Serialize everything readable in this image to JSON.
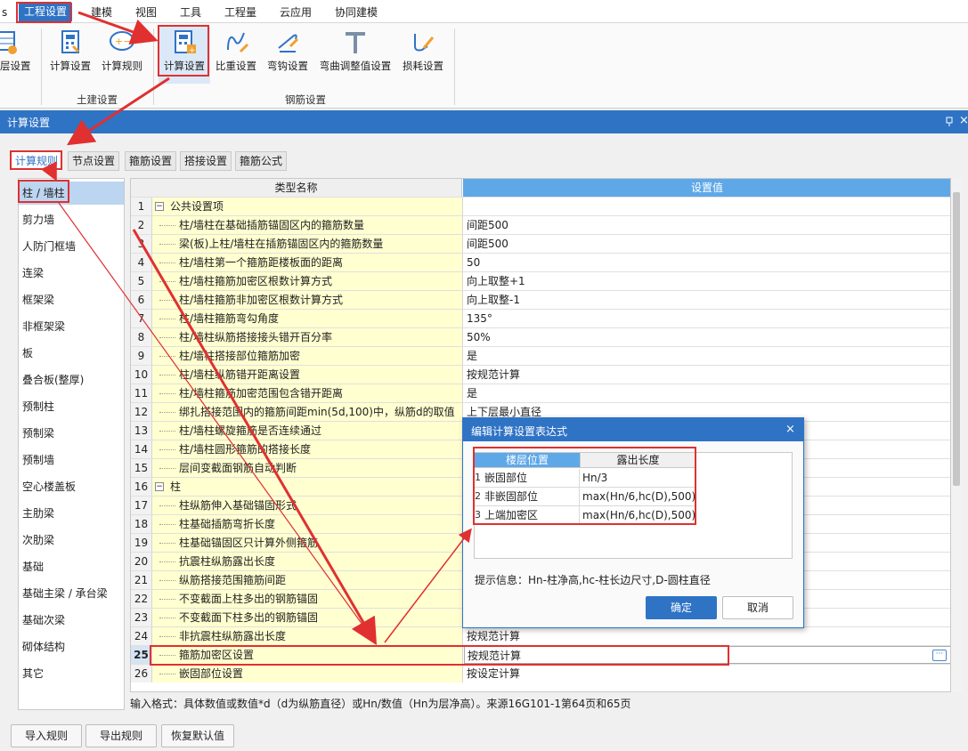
{
  "menu": {
    "items": [
      "工程设置",
      "建模",
      "视图",
      "工具",
      "工程量",
      "云应用",
      "协同建模"
    ]
  },
  "ribbon": {
    "buttons": [
      {
        "label": "层设置"
      },
      {
        "label": "计算设置"
      },
      {
        "label": "计算规则"
      },
      {
        "label": "计算设置"
      },
      {
        "label": "比重设置"
      },
      {
        "label": "弯钩设置"
      },
      {
        "label": "弯曲调整值设置"
      },
      {
        "label": "损耗设置"
      }
    ],
    "groups": [
      "土建设置",
      "钢筋设置"
    ]
  },
  "dialog": {
    "title": "计算设置",
    "close": "×",
    "tabs": [
      "计算规则",
      "节点设置",
      "箍筋设置",
      "搭接设置",
      "箍筋公式"
    ],
    "nav": [
      "柱 / 墙柱",
      "剪力墙",
      "人防门框墙",
      "连梁",
      "框架梁",
      "非框架梁",
      "板",
      "叠合板(整厚)",
      "预制柱",
      "预制梁",
      "预制墙",
      "空心楼盖板",
      "主肋梁",
      "次肋梁",
      "基础",
      "基础主梁 / 承台梁",
      "基础次梁",
      "砌体结构",
      "其它"
    ],
    "grid": {
      "headers": [
        "类型名称",
        "设置值"
      ],
      "rows": [
        {
          "n": "1",
          "name": "公共设置项",
          "value": "",
          "group": true,
          "toggle": "−"
        },
        {
          "n": "2",
          "name": "柱/墙柱在基础插筋锚固区内的箍筋数量",
          "value": "间距500"
        },
        {
          "n": "3",
          "name": "梁(板)上柱/墙柱在插筋锚固区内的箍筋数量",
          "value": "间距500"
        },
        {
          "n": "4",
          "name": "柱/墙柱第一个箍筋距楼板面的距离",
          "value": "50"
        },
        {
          "n": "5",
          "name": "柱/墙柱箍筋加密区根数计算方式",
          "value": "向上取整+1"
        },
        {
          "n": "6",
          "name": "柱/墙柱箍筋非加密区根数计算方式",
          "value": "向上取整-1"
        },
        {
          "n": "7",
          "name": "柱/墙柱箍筋弯勾角度",
          "value": "135°"
        },
        {
          "n": "8",
          "name": "柱/墙柱纵筋搭接接头错开百分率",
          "value": "50%"
        },
        {
          "n": "9",
          "name": "柱/墙柱搭接部位箍筋加密",
          "value": "是"
        },
        {
          "n": "10",
          "name": "柱/墙柱纵筋错开距离设置",
          "value": "按规范计算"
        },
        {
          "n": "11",
          "name": "柱/墙柱箍筋加密范围包含错开距离",
          "value": "是"
        },
        {
          "n": "12",
          "name": "绑扎搭接范围内的箍筋间距min(5d,100)中，纵筋d的取值",
          "value": "上下层最小直径"
        },
        {
          "n": "13",
          "name": "柱/墙柱螺旋箍筋是否连续通过",
          "value": ""
        },
        {
          "n": "14",
          "name": "柱/墙柱圆形箍筋的搭接长度",
          "value": ""
        },
        {
          "n": "15",
          "name": "层间变截面钢筋自动判断",
          "value": ""
        },
        {
          "n": "16",
          "name": "柱",
          "value": "",
          "group": true,
          "toggle": "−"
        },
        {
          "n": "17",
          "name": "柱纵筋伸入基础锚固形式",
          "value": ""
        },
        {
          "n": "18",
          "name": "柱基础插筋弯折长度",
          "value": ""
        },
        {
          "n": "19",
          "name": "柱基础锚固区只计算外侧箍筋",
          "value": ""
        },
        {
          "n": "20",
          "name": "抗震柱纵筋露出长度",
          "value": ""
        },
        {
          "n": "21",
          "name": "纵筋搭接范围箍筋间距",
          "value": ""
        },
        {
          "n": "22",
          "name": "不变截面上柱多出的钢筋锚固",
          "value": ""
        },
        {
          "n": "23",
          "name": "不变截面下柱多出的钢筋锚固",
          "value": ""
        },
        {
          "n": "24",
          "name": "非抗震柱纵筋露出长度",
          "value": "按规范计算"
        },
        {
          "n": "25",
          "name": "箍筋加密区设置",
          "value": "按规范计算",
          "selected": true
        },
        {
          "n": "26",
          "name": "嵌固部位设置",
          "value": "按设定计算"
        }
      ],
      "ellipsis": "···"
    },
    "input_format": "输入格式：具体数值或数值*d（d为纵筋直径）或Hn/数值（Hn为层净高）。来源16G101-1第64页和65页",
    "bottom_buttons": [
      "导入规则",
      "导出规则",
      "恢复默认值"
    ]
  },
  "popup": {
    "title": "编辑计算设置表达式",
    "close": "×",
    "headers": [
      "楼层位置",
      "露出长度"
    ],
    "rows": [
      {
        "n": "1",
        "pos": "嵌固部位",
        "len": "Hn/3"
      },
      {
        "n": "2",
        "pos": "非嵌固部位",
        "len": "max(Hn/6,hc(D),500)"
      },
      {
        "n": "3",
        "pos": "上端加密区",
        "len": "max(Hn/6,hc(D),500)"
      }
    ],
    "hint": "提示信息：Hn-柱净高,hc-柱长边尺寸,D-圆柱直径",
    "ok": "确定",
    "cancel": "取消"
  }
}
